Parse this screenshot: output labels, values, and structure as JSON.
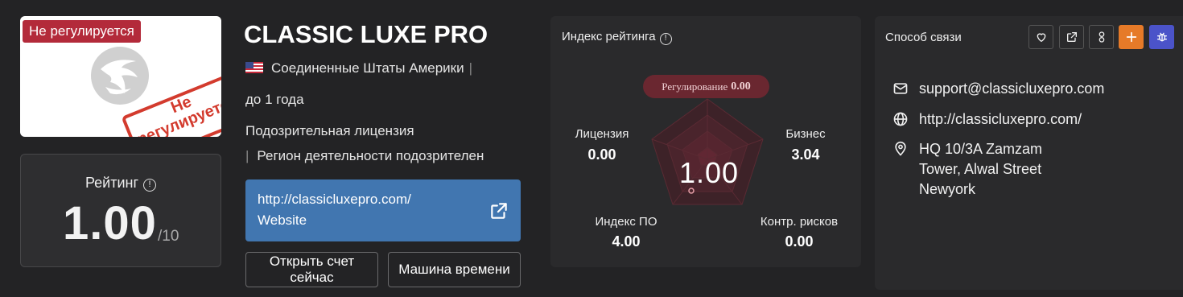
{
  "broker": {
    "tag": "Не регулируется",
    "stamp_line1": "Не",
    "stamp_line2": "регулируется",
    "name": "CLASSIC LUXE PRO",
    "country": "Соединенные Штаты Америки",
    "age": "до 1 года",
    "license_status": "Подозрительная лицензия",
    "region_status": "Регион деятельности подозрителен",
    "website_url": "http://classicluxepro.com/",
    "website_label": "Website",
    "open_account_label": "Открыть счет сейчас",
    "time_machine_label": "Машина времени"
  },
  "rating": {
    "title": "Рейтинг",
    "value": "1.00",
    "max": "/10"
  },
  "radar": {
    "title": "Индекс рейтинга",
    "regulation_label": "Регулирование",
    "regulation_value": "0.00",
    "center_score": "1.00",
    "axes": [
      {
        "label": "Лицензия",
        "value": "0.00"
      },
      {
        "label": "Бизнес",
        "value": "3.04"
      },
      {
        "label": "Индекс ПО",
        "value": "4.00"
      },
      {
        "label": "Контр. рисков",
        "value": "0.00"
      }
    ]
  },
  "contact": {
    "title": "Способ связи",
    "email": "support@classicluxepro.com",
    "website": "http://classicluxepro.com/",
    "address": "HQ 10/3A Zamzam Tower, Alwal Street Newyork",
    "toolbar": [
      "heart-icon",
      "share-icon",
      "user-icon",
      "plus-icon",
      "bug-icon"
    ]
  },
  "colors": {
    "background": "#232325",
    "card": "#2a2a2c",
    "tag_red": "#b32a3a",
    "stamp_red": "#d33b2e",
    "website_blue": "#4176b0",
    "accent_orange": "#e67a28",
    "accent_purple": "#4b53c9"
  }
}
